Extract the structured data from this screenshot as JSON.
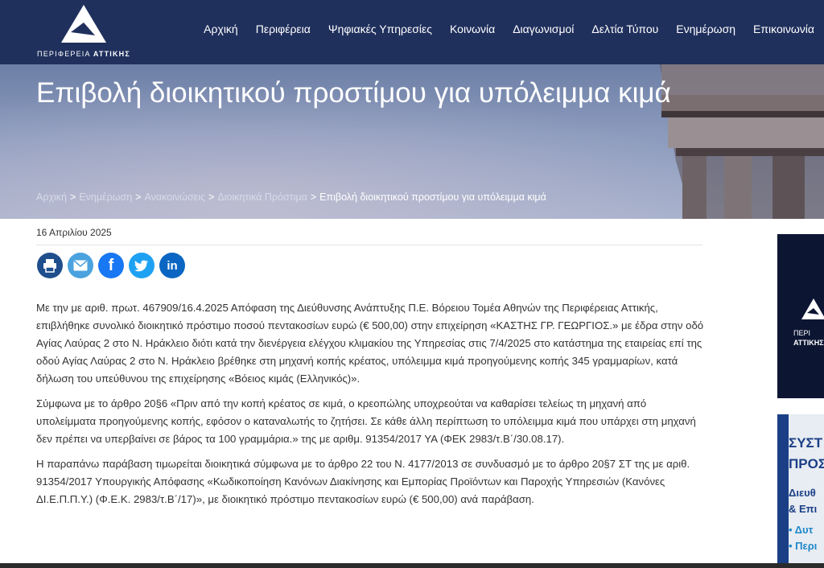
{
  "header": {
    "logo_text_1": "ΠΕΡΙΦΕΡΕΙΑ",
    "logo_text_2": "ΑΤΤΙΚΗΣ",
    "nav": [
      "Αρχική",
      "Περιφέρεια",
      "Ψηφιακές Υπηρεσίες",
      "Κοινωνία",
      "Διαγωνισμοί",
      "Δελτία Τύπου",
      "Ενημέρωση",
      "Επικοινωνία"
    ]
  },
  "hero": {
    "title": "Επιβολή διοικητικού προστίμου για υπόλειμμα κιμά",
    "breadcrumb": {
      "items": [
        "Αρχική",
        "Ενημέρωση",
        "Ανακοινώσεις",
        "Διοικητικά Πρόστιμα"
      ],
      "separator": ">",
      "current": "Επιβολή διοικητικού προστίμου για υπόλειμμα κιμά"
    }
  },
  "article": {
    "date": "16 Απριλίου 2025",
    "share_icons": [
      "print-icon",
      "email-icon",
      "facebook-icon",
      "twitter-icon",
      "linkedin-icon"
    ],
    "paragraphs": [
      "Με την με αριθ. πρωτ. 467909/16.4.2025 Απόφαση της Διεύθυνσης Ανάπτυξης Π.Ε. Βόρειου Τομέα Αθηνών της Περιφέρειας Αττικής, επιβλήθηκε συνολικό διοικητικό πρόστιμο ποσού πεντακοσίων ευρώ (€ 500,00) στην επιχείρηση «ΚΑΣΤΗΣ ΓΡ. ΓΕΩΡΓΙΟΣ.» με έδρα στην οδό Αγίας Λαύρας 2 στο Ν. Ηράκλειο διότι κατά την διενέργεια ελέγχου κλιμακίου της Υπηρεσίας στις 7/4/2025 στο κατάστημα της εταιρείας επί της οδού Αγίας Λαύρας 2 στο Ν. Ηράκλειο βρέθηκε στη μηχανή κοπής κρέατος, υπόλειμμα κιμά προηγούμενης κοπής 345 γραμμαρίων, κατά δήλωση του υπεύθυνου της επιχείρησης «Βόειος κιμάς (Ελληνικός)».",
      "Σύμφωνα με το άρθρο 20§6 «Πριν από την κοπή κρέατος σε κιμά, ο κρεοπώλης υποχρεούται να καθαρίσει τελείως τη μηχανή από υπολείμματα προηγούμενης κοπής, εφόσον ο καταναλωτής το ζητήσει. Σε κάθε άλλη περίπτωση το υπόλειμμα κιμά που υπάρχει στη μηχανή δεν πρέπει να υπερβαίνει σε βάρος τα 100 γραμμάρια.» της με αριθμ. 91354/2017 ΥΑ (ΦΕΚ 2983/τ.Β΄/30.08.17).",
      "Η παραπάνω παράβαση τιμωρείται διοικητικά σύμφωνα με το άρθρο 22 του Ν. 4177/2013 σε συνδυασμό με το άρθρο 20§7 ΣΤ της με αριθ. 91354/2017 Υπουργικής Απόφασης «Κωδικοποίηση Κανόνων Διακίνησης και Εμπορίας Προϊόντων και Παροχής Υπηρεσιών (Κανόνες ΔΙ.Ε.Π.Π.Υ.) (Φ.Ε.Κ. 2983/τ.Β΄/17)», με διοικητικό πρόστιμο πεντακοσίων ευρώ (€ 500,00) ανά παράβαση."
    ]
  },
  "sidebar": {
    "banner1_line1": "ΠΕΡΙ",
    "banner1_line2": "ΑΤΤΙΚΗΣ",
    "banner2_lines": [
      "ΣΥΣΤ",
      "ΠΡΟΣ",
      "Διευθ",
      "& Επι",
      "• Δυτ",
      "• Περι"
    ]
  },
  "colors": {
    "header_bg": "#20305d",
    "print": "#1f4e8c",
    "email": "#4aa3df",
    "facebook": "#1877f2",
    "twitter": "#1da1f2",
    "linkedin": "#0a66c2"
  }
}
